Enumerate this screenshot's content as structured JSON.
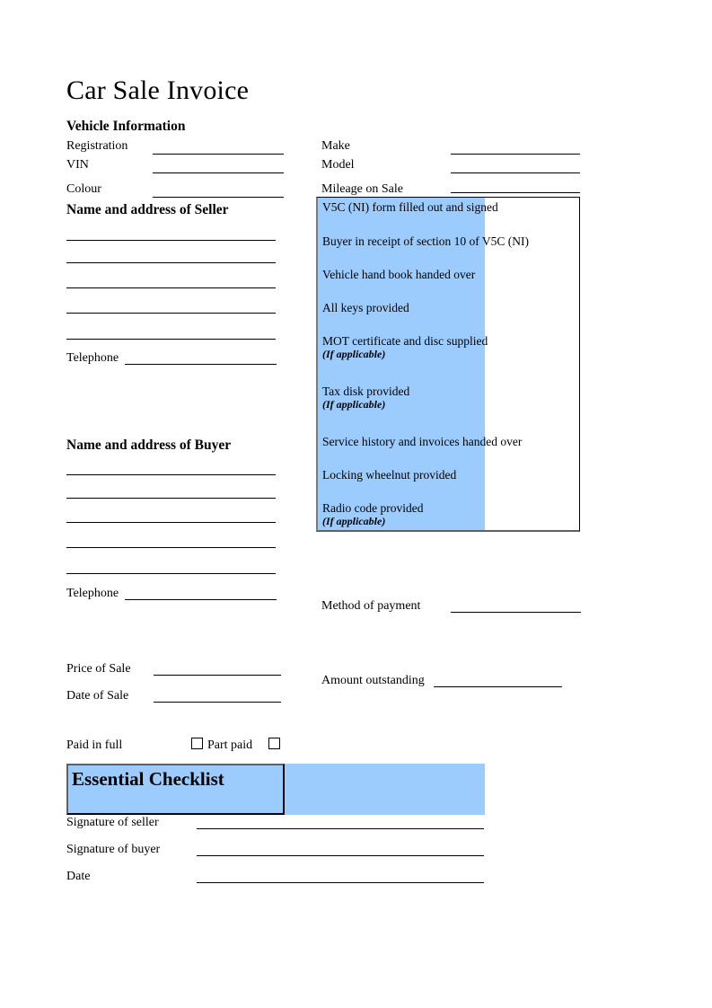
{
  "document": {
    "title": "Car Sale Invoice"
  },
  "vehicle_information": {
    "heading": "Vehicle Information",
    "left_fields": [
      {
        "label": "Registration",
        "value": ""
      },
      {
        "label": "VIN",
        "value": ""
      },
      {
        "label": "Colour",
        "value": ""
      }
    ],
    "right_fields": [
      {
        "label": "Make",
        "value": ""
      },
      {
        "label": "Model",
        "value": ""
      },
      {
        "label": "Mileage on Sale",
        "value": ""
      }
    ]
  },
  "seller": {
    "heading": "Name and address of Seller",
    "address_lines": [
      "",
      "",
      "",
      "",
      ""
    ],
    "telephone_label": "Telephone",
    "telephone_value": ""
  },
  "buyer": {
    "heading": "Name and address of Buyer",
    "address_lines": [
      "",
      "",
      "",
      "",
      ""
    ],
    "telephone_label": "Telephone",
    "telephone_value": ""
  },
  "checklist": {
    "items": [
      {
        "text": "V5C (NI) form filled out and signed",
        "note": ""
      },
      {
        "text": "Buyer in receipt of section 10 of V5C (NI)",
        "note": ""
      },
      {
        "text": "Vehicle hand book handed over",
        "note": ""
      },
      {
        "text": "All keys provided",
        "note": ""
      },
      {
        "text": "MOT certificate and disc supplied",
        "note": "(If applicable)"
      },
      {
        "text": "Tax disk provided",
        "note": "(If applicable)"
      },
      {
        "text": "Service history and invoices handed over",
        "note": ""
      },
      {
        "text": "Locking wheelnut provided",
        "note": ""
      },
      {
        "text": "Radio code provided",
        "note": "(If applicable)"
      }
    ]
  },
  "payment": {
    "method_label": "Method of payment",
    "method_value": "",
    "price_label": "Price of Sale",
    "price_value": "",
    "date_label": "Date of Sale",
    "date_value": "",
    "amount_outstanding_label": "Amount outstanding",
    "amount_outstanding_value": "",
    "paid_in_full_label": "Paid in full",
    "part_paid_label": "Part paid",
    "paid_in_full_checked": false,
    "part_paid_checked": false
  },
  "essential_checklist": {
    "title": "Essential Checklist"
  },
  "signatures": [
    {
      "label": "Signature of seller",
      "value": ""
    },
    {
      "label": "Signature of buyer",
      "value": ""
    },
    {
      "label": "Date",
      "value": ""
    }
  ],
  "colors": {
    "highlight_blue": "#9CCCFE",
    "rule_black": "#000000",
    "box_border_grey": "#62615f"
  }
}
